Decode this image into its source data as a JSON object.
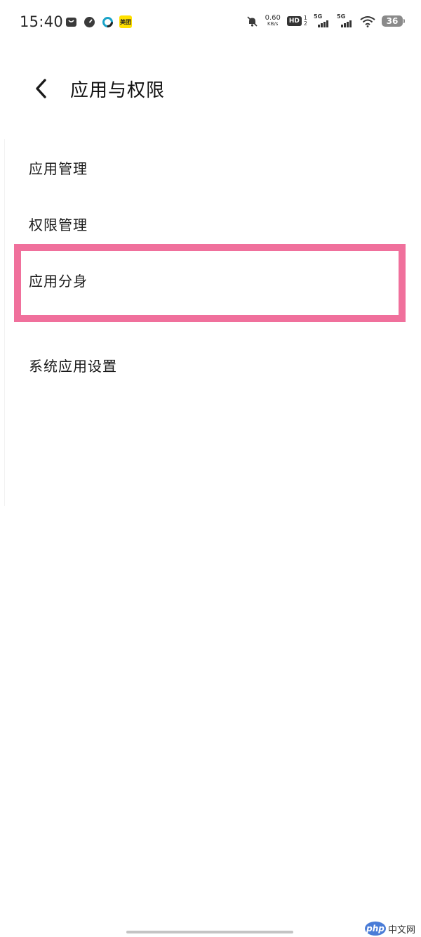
{
  "status_bar": {
    "time": "15:40",
    "badge_text": "美团",
    "net_speed": "0.60",
    "net_speed_unit": "KB/s",
    "hd_label": "HD",
    "sim_top": "1",
    "sim_bottom": "2",
    "sim1_network": "5G",
    "sim2_network": "5G",
    "battery_level": "36"
  },
  "header": {
    "title": "应用与权限"
  },
  "list": {
    "items": [
      {
        "label": "应用管理"
      },
      {
        "label": "权限管理"
      },
      {
        "label": "应用分身"
      },
      {
        "label": "系统应用设置"
      }
    ]
  },
  "watermark": {
    "logo": "php",
    "text": "中文网"
  },
  "colors": {
    "highlight": "#f0709c",
    "background": "#ffffff",
    "text": "#1a1a1a"
  }
}
